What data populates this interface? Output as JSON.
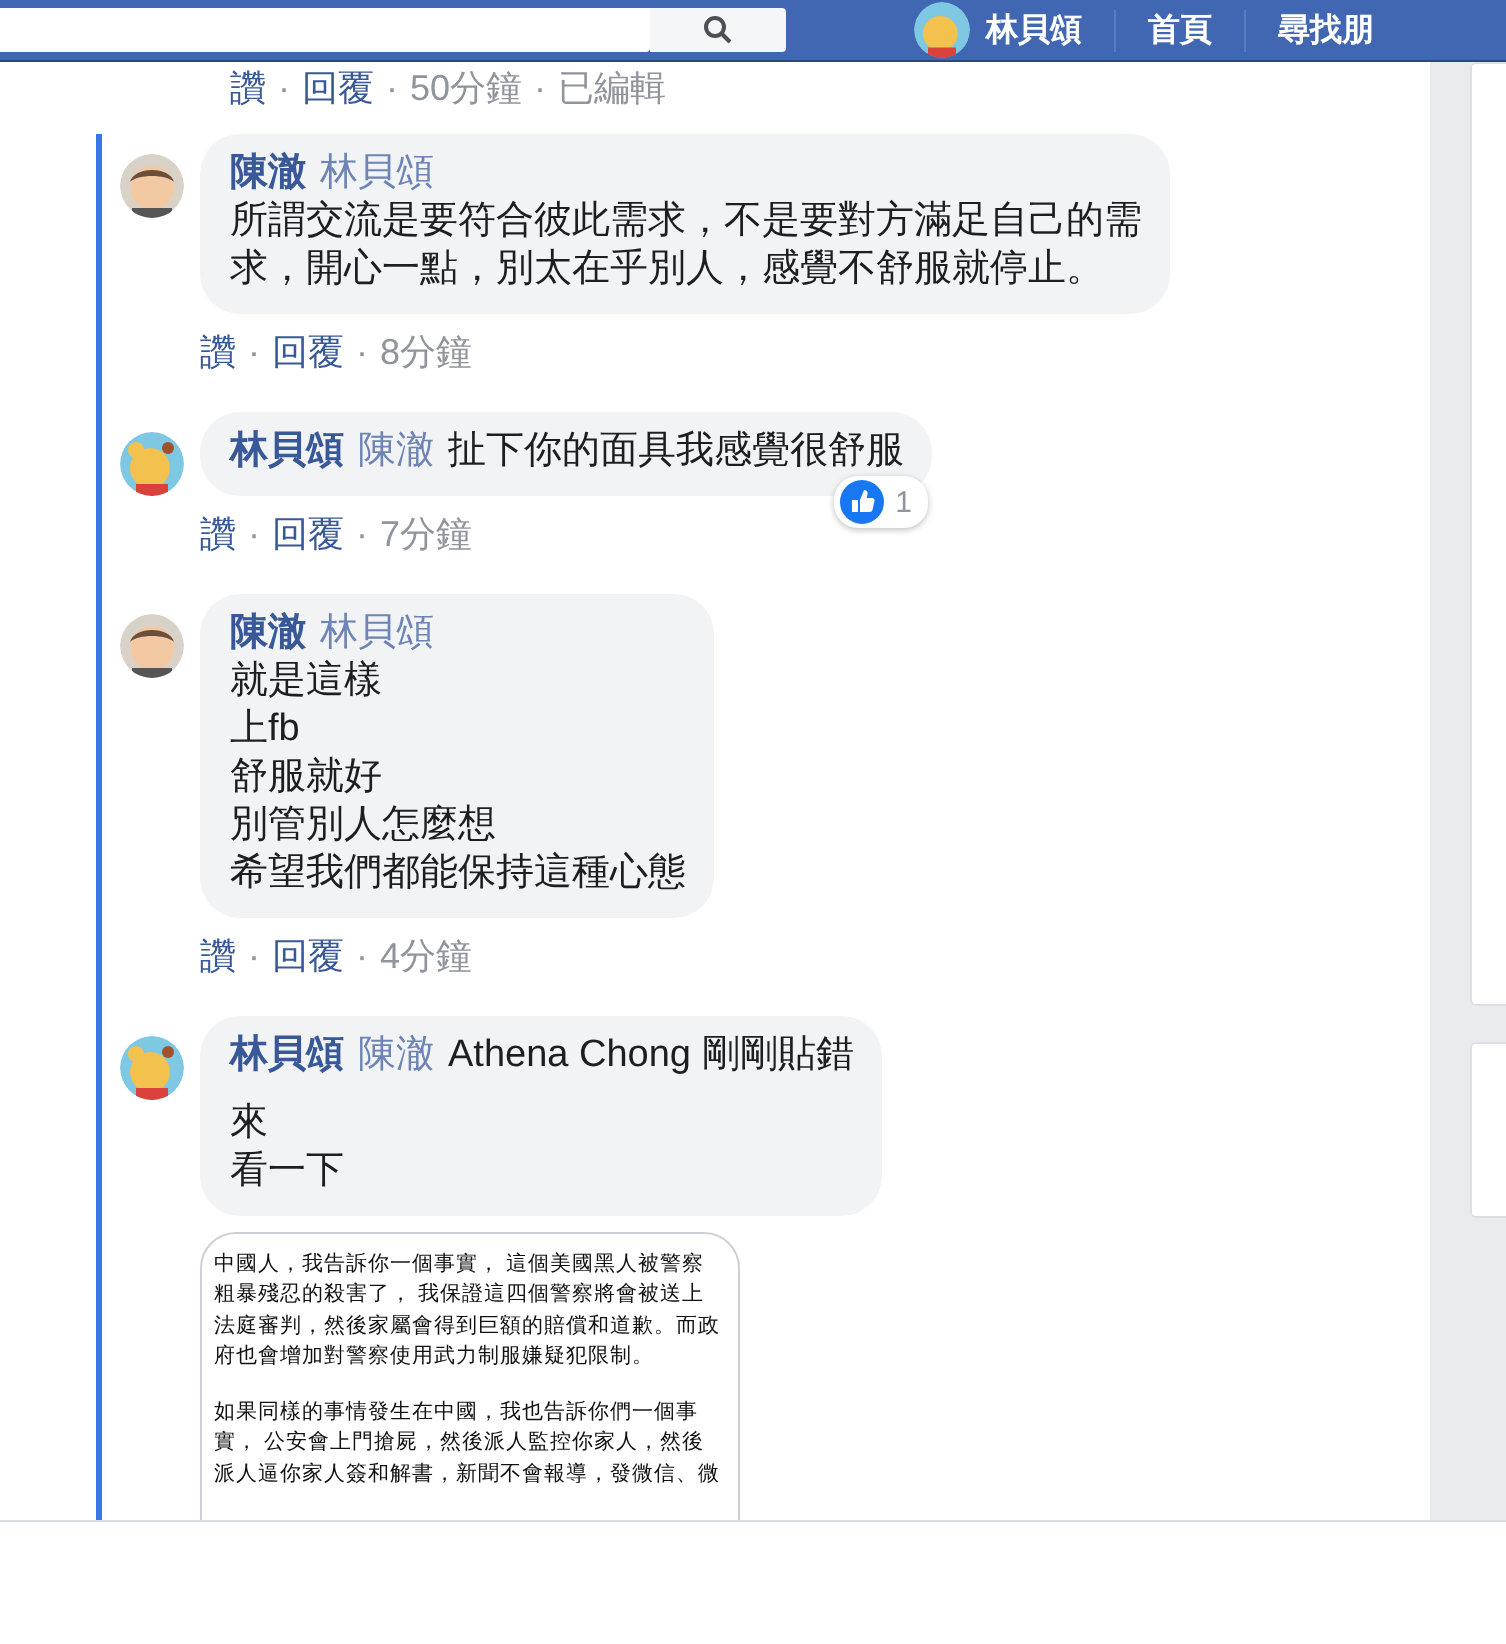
{
  "header": {
    "profile_name": "林貝頌",
    "nav": [
      "首頁",
      "尋找朋"
    ]
  },
  "top_meta": {
    "like": "讚",
    "separator": "·",
    "reply": "回覆",
    "time": "50分鐘",
    "edited": "已編輯"
  },
  "comments": [
    {
      "avatar": {
        "kind": "baby"
      },
      "author": "陳澈",
      "mention": "林貝頌",
      "lines": [
        "所謂交流是要符合彼此需求，不是要對方滿足自己的需",
        "求，開心一點，別太在乎別人，感覺不舒服就停止。"
      ],
      "meta": {
        "like": "讚",
        "separator": "·",
        "reply": "回覆",
        "time": "8分鐘"
      }
    },
    {
      "avatar": {
        "kind": "cartoon"
      },
      "author": "林貝頌",
      "mention": "陳澈",
      "inline_text": "扯下你的面具我感覺很舒服",
      "reaction": {
        "count": "1"
      },
      "meta": {
        "like": "讚",
        "separator": "·",
        "reply": "回覆",
        "time": "7分鐘"
      }
    },
    {
      "avatar": {
        "kind": "baby"
      },
      "author": "陳澈",
      "mention": "林貝頌",
      "lines": [
        "就是這樣",
        "上fb",
        "舒服就好",
        "別管別人怎麼想",
        "希望我們都能保持這種心態"
      ],
      "meta": {
        "like": "讚",
        "separator": "·",
        "reply": "回覆",
        "time": "4分鐘"
      }
    },
    {
      "avatar": {
        "kind": "cartoon"
      },
      "author": "林貝頌",
      "mention": "陳澈",
      "inline_text": "Athena Chong 剛剛貼錯",
      "lines": [
        "來",
        "看一下"
      ],
      "attachment": {
        "paragraphs": [
          [
            "中國人，我告訴你一個事實， 這個美國黑人被警察",
            "粗暴殘忍的殺害了， 我保證這四個警察將會被送上",
            "法庭審判，然後家屬會得到巨額的賠償和道歉。而政",
            "府也會增加對警察使用武力制服嫌疑犯限制。"
          ],
          [
            "如果同樣的事情發生在中國，我也告訴你們一個事",
            "實， 公安會上門搶屍，然後派人監控你家人，然後",
            "派人逼你家人簽和解書，新聞不會報導，發微信、微"
          ]
        ]
      }
    }
  ]
}
